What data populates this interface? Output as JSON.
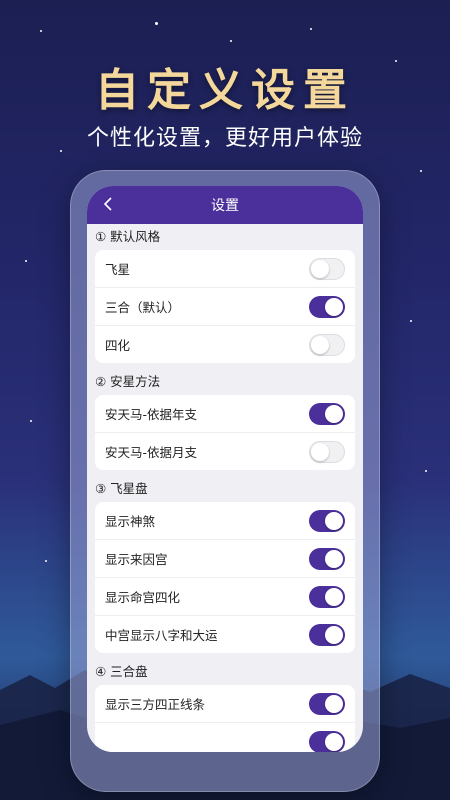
{
  "hero": {
    "title": "自定义设置",
    "subtitle": "个性化设置，更好用户体验"
  },
  "appbar": {
    "title": "设置",
    "back_icon": "chevron-left-icon"
  },
  "sections": [
    {
      "title": "① 默认风格",
      "items": [
        {
          "label": "飞星",
          "on": false
        },
        {
          "label": "三合（默认）",
          "on": true
        },
        {
          "label": "四化",
          "on": false
        }
      ]
    },
    {
      "title": "② 安星方法",
      "items": [
        {
          "label": "安天马-依据年支",
          "on": true
        },
        {
          "label": "安天马-依据月支",
          "on": false
        }
      ]
    },
    {
      "title": "③ 飞星盘",
      "items": [
        {
          "label": "显示神煞",
          "on": true
        },
        {
          "label": "显示来因宫",
          "on": true
        },
        {
          "label": "显示命宫四化",
          "on": true
        },
        {
          "label": "中宫显示八字和大运",
          "on": true
        }
      ]
    },
    {
      "title": "④ 三合盘",
      "items": [
        {
          "label": "显示三方四正线条",
          "on": true
        },
        {
          "label": "",
          "on": true
        }
      ]
    }
  ],
  "colors": {
    "accent": "#4b2f9a",
    "title_gold": "#f4d79a"
  }
}
